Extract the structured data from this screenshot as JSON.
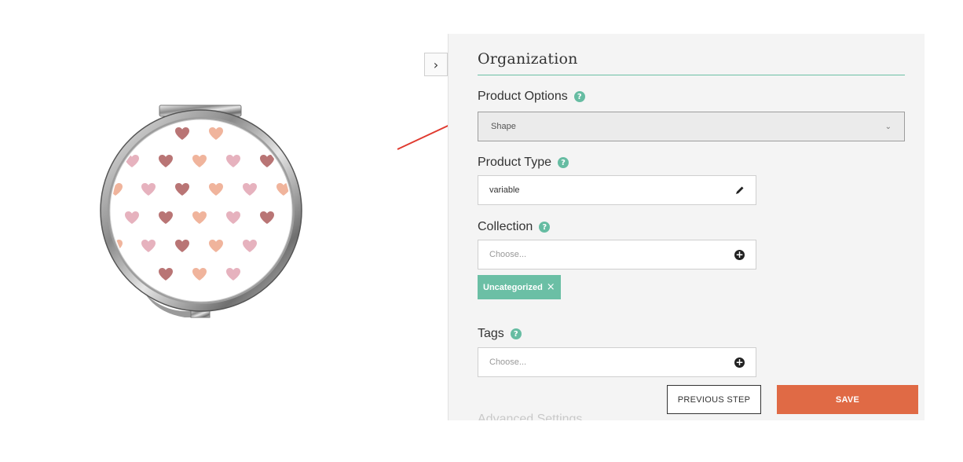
{
  "panel": {
    "toggle_icon": "chevron-right-icon",
    "section_title": "Organization",
    "next_section_title": "Advanced Settings"
  },
  "product_options": {
    "label": "Product Options",
    "selected": "Shape"
  },
  "product_type": {
    "label": "Product Type",
    "value": "variable",
    "icon": "pencil-icon"
  },
  "collection": {
    "label": "Collection",
    "placeholder": "Choose...",
    "chips": [
      "Uncategorized"
    ]
  },
  "tags": {
    "label": "Tags",
    "placeholder": "Choose..."
  },
  "actions": {
    "previous_label": "PREVIOUS STEP",
    "save_label": "SAVE"
  },
  "colors": {
    "accent": "#6bbfa5",
    "save": "#e06a45",
    "annotation": "#e03a2f"
  }
}
